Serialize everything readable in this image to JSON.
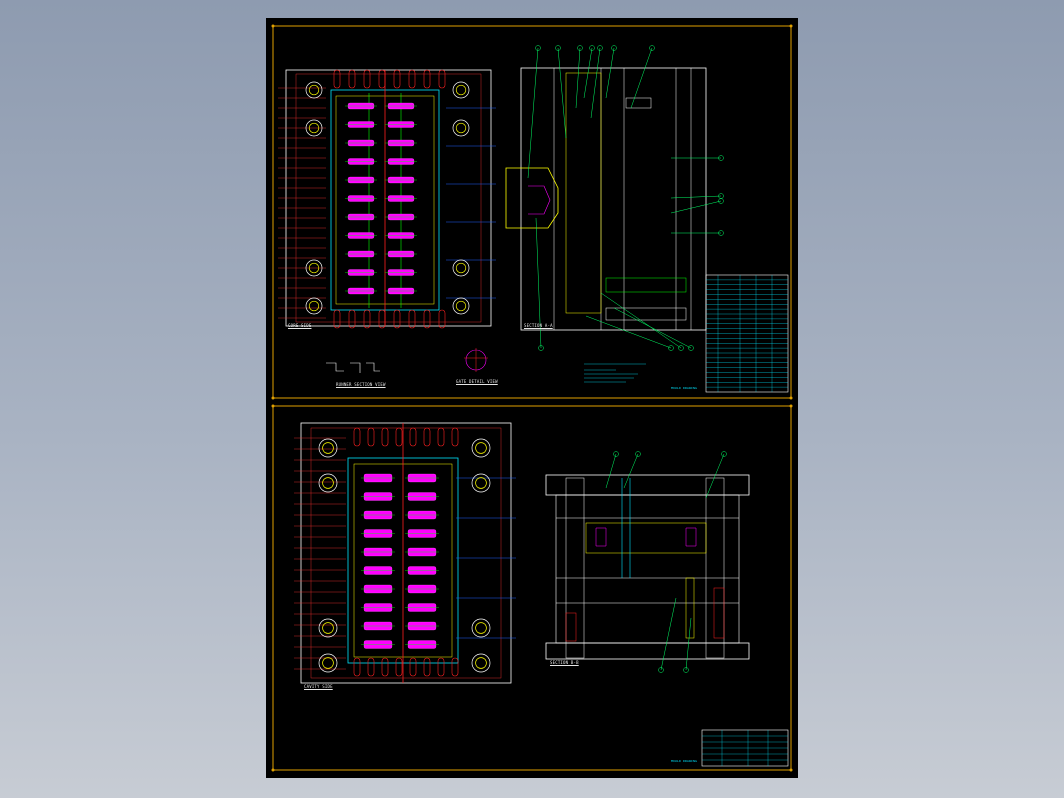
{
  "sheet_1": {
    "moving_side_label": "CORE SIDE",
    "section_label": "SECTION A-A",
    "detail_label_1": "RUNNER SECTION VIEW",
    "detail_label_2": "GATE DETAIL VIEW",
    "title_block_name": "MOULD DRAWING"
  },
  "sheet_2": {
    "fixed_side_label": "CAVITY SIDE",
    "section_label": "SECTION B-B",
    "title_block_name": "MOULD DRAWING"
  },
  "colors": {
    "sheet_bg": "#000000",
    "frame": "#e0a000",
    "plate_outline": "#ffffff",
    "cavity_fill": "#ff00ff",
    "runner": "#ff2020",
    "cooling": "#00e5ff",
    "ejector": "#00ff00",
    "leader": "#00ff66",
    "dimension": "#ff3030",
    "yellow_parts": "#ffff00",
    "blue_lines": "#2060ff"
  },
  "icons": {
    "balloon": "circled-item-number",
    "cavity": "magenta-part-cavity"
  }
}
